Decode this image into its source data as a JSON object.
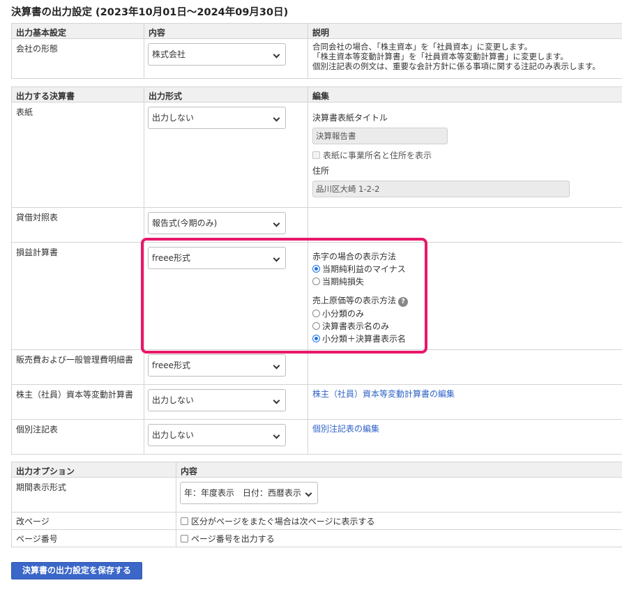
{
  "page": {
    "title": "決算書の出力設定 (2023年10月01日〜2024年09月30日)"
  },
  "basic": {
    "headers": [
      "出力基本設定",
      "内容",
      "説明"
    ],
    "company_type_label": "会社の形態",
    "company_type_value": "株式会社",
    "description": [
      "合同会社の場合、「株主資本」を「社員資本」に変更します。",
      "「株主資本等変動計算書」を「社員資本等変動計算書」に変更します。",
      "個別注記表の例文は、重要な会計方針に係る事項に関する注記のみ表示します。"
    ]
  },
  "statements": {
    "headers": [
      "出力する決算書",
      "出力形式",
      "編集"
    ],
    "cover": {
      "label": "表紙",
      "format": "出力しない",
      "title_label": "決算書表紙タイトル",
      "title_value": "決算報告書",
      "show_address_label": "表紙に事業所名と住所を表示",
      "address_label": "住所",
      "address_value": "品川区大崎 1-2-2"
    },
    "balance_sheet": {
      "label": "貸借対照表",
      "format": "報告式(今期のみ)"
    },
    "income_statement": {
      "label": "損益計算書",
      "format": "freee形式",
      "deficit_title": "赤字の場合の表示方法",
      "deficit_options": [
        "当期純利益のマイナス",
        "当期純損失"
      ],
      "deficit_selected": 0,
      "cogs_title": "売上原価等の表示方法",
      "cogs_options": [
        "小分類のみ",
        "決算書表示名のみ",
        "小分類＋決算書表示名"
      ],
      "cogs_selected": 2
    },
    "sga": {
      "label": "販売費および一般管理費明細書",
      "format": "freee形式"
    },
    "equity_changes": {
      "label": "株主（社員）資本等変動計算書",
      "format": "出力しない",
      "edit_link": "株主（社員）資本等変動計算書の編集"
    },
    "notes": {
      "label": "個別注記表",
      "format": "出力しない",
      "edit_link": "個別注記表の編集"
    }
  },
  "options": {
    "headers": [
      "出力オプション",
      "内容"
    ],
    "period_label": "期間表示形式",
    "period_value": "年：年度表示　日付：西暦表示",
    "page_break_label": "改ページ",
    "page_break_text": "区分がページをまたぐ場合は次ページに表示する",
    "page_number_label": "ページ番号",
    "page_number_text": "ページ番号を出力する"
  },
  "actions": {
    "save_label": "決算書の出力設定を保存する"
  },
  "colors": {
    "accent": "#3b67c9",
    "highlight": "#e8176a",
    "link": "#2f62c6"
  }
}
